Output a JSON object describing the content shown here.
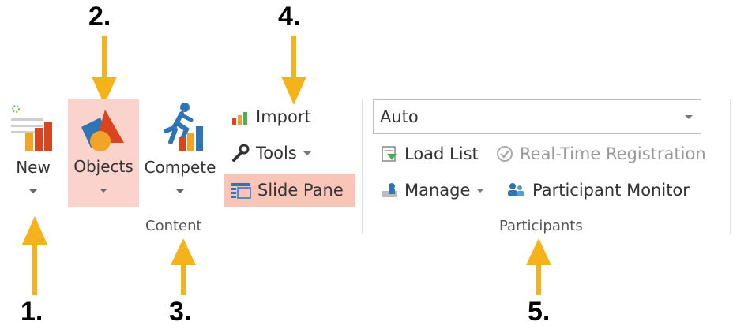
{
  "callouts": [
    "1.",
    "2.",
    "3.",
    "4.",
    "5."
  ],
  "ribbon": {
    "new_label": "New",
    "objects_label": "Objects",
    "compete_label": "Compete",
    "content_group_label": "Content",
    "import_label": "Import",
    "tools_label": "Tools",
    "slide_pane_label": "Slide Pane",
    "auto_value": "Auto",
    "load_list_label": "Load List",
    "realtime_label": "Real-Time Registration",
    "manage_label": "Manage",
    "participant_monitor_label": "Participant Monitor",
    "participants_group_label": "Participants"
  },
  "colors": {
    "arrow": "#F5B31B",
    "highlight": "#FAD4CC",
    "highlight_strong": "#F8C5B8",
    "bar_red": "#D9451E",
    "bar_orange": "#F2A428",
    "bar_blue": "#2E75B6"
  },
  "icons": [
    "new-icon",
    "objects-icon",
    "compete-icon",
    "import-icon",
    "tools-icon",
    "slide-pane-icon",
    "load-list-icon",
    "realtime-registration-icon",
    "manage-icon",
    "participant-monitor-icon"
  ]
}
